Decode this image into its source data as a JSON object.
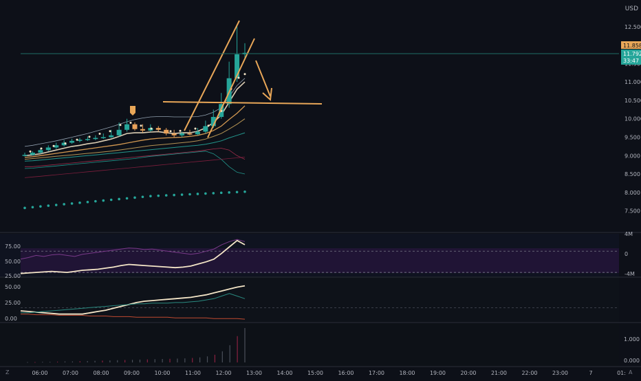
{
  "currency_label": "USD",
  "price_axis": {
    "ticks": [
      "12.500",
      "12.000",
      "11.500",
      "11.000",
      "10.500",
      "10.000",
      "9.500",
      "9.000",
      "8.500",
      "8.000",
      "7.500"
    ],
    "ymin": 7.25,
    "ymax": 13.0,
    "current_price_label": "11.858",
    "last_price_label": "11.792",
    "countdown_label": "33:47",
    "current_price": 11.858,
    "last_price": 11.792
  },
  "osc_axis": {
    "ticks": [
      "75.00",
      "50.00",
      "25.00"
    ],
    "right_ticks": [
      "4M",
      "0",
      "-4M"
    ]
  },
  "adx_axis": {
    "ticks": [
      "50.00",
      "25.00",
      "0.00"
    ]
  },
  "vol_axis": {
    "ticks": [
      "1.000",
      "0.000"
    ]
  },
  "time_axis": {
    "labels": [
      "06:00",
      "07:00",
      "08:00",
      "09:00",
      "10:00",
      "11:00",
      "12:00",
      "13:00",
      "14:00",
      "15:00",
      "16:00",
      "17:00",
      "18:00",
      "19:00",
      "20:00",
      "21:00",
      "22:00",
      "23:00",
      "7",
      "01:"
    ]
  },
  "corner_labels": {
    "left": "Z",
    "right": "A"
  },
  "colors": {
    "background": "#0d1018",
    "bull": "#26a69a",
    "bear": "#e8a15a",
    "annotation": "#e9a758",
    "rsi_band": "#2a1640"
  },
  "chart_data": [
    {
      "type": "candlestick",
      "x": [
        "05:45",
        "06:00",
        "06:15",
        "06:30",
        "06:45",
        "07:00",
        "07:15",
        "07:30",
        "07:45",
        "08:00",
        "08:15",
        "08:30",
        "08:45",
        "09:00",
        "09:15",
        "09:30",
        "09:45",
        "10:00",
        "10:15",
        "10:30",
        "10:45",
        "11:00",
        "11:15",
        "11:30",
        "11:45",
        "12:00",
        "12:15",
        "12:30",
        "12:45"
      ],
      "open": [
        9.0,
        9.02,
        9.08,
        9.15,
        9.22,
        9.28,
        9.35,
        9.4,
        9.43,
        9.45,
        9.48,
        9.5,
        9.55,
        9.7,
        9.85,
        9.72,
        9.68,
        9.75,
        9.7,
        9.6,
        9.55,
        9.6,
        9.58,
        9.65,
        9.8,
        10.05,
        10.4,
        11.1,
        11.75
      ],
      "close": [
        9.02,
        9.08,
        9.15,
        9.22,
        9.28,
        9.35,
        9.4,
        9.43,
        9.45,
        9.48,
        9.5,
        9.55,
        9.7,
        9.85,
        9.72,
        9.68,
        9.75,
        9.7,
        9.6,
        9.55,
        9.6,
        9.58,
        9.65,
        9.8,
        10.05,
        10.4,
        11.1,
        11.75,
        11.79
      ],
      "high": [
        9.08,
        9.12,
        9.2,
        9.28,
        9.35,
        9.42,
        9.46,
        9.48,
        9.52,
        9.55,
        9.6,
        9.7,
        9.9,
        10.0,
        9.9,
        9.85,
        9.85,
        9.8,
        9.75,
        9.7,
        9.65,
        9.7,
        9.75,
        9.95,
        10.25,
        10.7,
        11.55,
        12.55,
        12.05
      ],
      "low": [
        8.98,
        9.0,
        9.05,
        9.12,
        9.18,
        9.25,
        9.32,
        9.36,
        9.4,
        9.42,
        9.45,
        9.48,
        9.52,
        9.65,
        9.68,
        9.62,
        9.65,
        9.65,
        9.55,
        9.5,
        9.5,
        9.55,
        9.55,
        9.6,
        9.75,
        10.0,
        10.3,
        11.0,
        11.6
      ]
    },
    {
      "type": "line",
      "name": "",
      "x_range": [
        "05:45",
        "12:45"
      ],
      "series": [
        {
          "values": [
            9.0,
            9.02,
            9.05,
            9.1,
            9.15,
            9.2,
            9.25,
            9.28,
            9.32,
            9.35,
            9.4,
            9.45,
            9.52,
            9.6,
            9.62,
            9.62,
            9.64,
            9.65,
            9.62,
            9.6,
            9.62,
            9.62,
            9.66,
            9.75,
            9.9,
            10.1,
            10.45,
            10.8,
            11.0
          ]
        },
        {
          "values": [
            8.95,
            8.97,
            9.0,
            9.03,
            9.06,
            9.09,
            9.12,
            9.15,
            9.18,
            9.21,
            9.24,
            9.27,
            9.3,
            9.34,
            9.38,
            9.42,
            9.45,
            9.47,
            9.48,
            9.49,
            9.5,
            9.52,
            9.55,
            9.6,
            9.68,
            9.8,
            9.98,
            10.15,
            10.35
          ]
        },
        {
          "values": [
            8.9,
            8.92,
            8.94,
            8.96,
            8.98,
            9.0,
            9.02,
            9.04,
            9.06,
            9.08,
            9.1,
            9.12,
            9.15,
            9.18,
            9.21,
            9.24,
            9.27,
            9.29,
            9.31,
            9.33,
            9.35,
            9.37,
            9.4,
            9.45,
            9.52,
            9.6,
            9.72,
            9.85,
            10.0
          ]
        },
        {
          "values": [
            8.85,
            8.86,
            8.88,
            8.9,
            8.92,
            8.94,
            8.96,
            8.98,
            9.0,
            9.02,
            9.04,
            9.06,
            9.08,
            9.1,
            9.12,
            9.14,
            9.16,
            9.18,
            9.2,
            9.22,
            9.24,
            9.26,
            9.28,
            9.31,
            9.35,
            9.4,
            9.48,
            9.55,
            9.62
          ]
        },
        {
          "values": [
            9.25,
            9.28,
            9.32,
            9.36,
            9.4,
            9.45,
            9.5,
            9.55,
            9.6,
            9.66,
            9.72,
            9.78,
            9.85,
            9.92,
            9.98,
            10.02,
            10.05,
            10.06,
            10.06,
            10.05,
            10.05,
            10.05,
            10.06,
            10.1,
            10.18,
            10.3,
            10.6,
            10.9,
            11.1
          ]
        },
        {
          "values": [
            8.7,
            8.7,
            8.72,
            8.74,
            8.76,
            8.78,
            8.8,
            8.82,
            8.84,
            8.86,
            8.88,
            8.9,
            8.92,
            8.94,
            8.96,
            8.98,
            9.0,
            9.02,
            9.04,
            9.06,
            9.08,
            9.1,
            9.12,
            9.15,
            9.18,
            9.2,
            9.15,
            9.0,
            8.9
          ]
        },
        {
          "values": [
            8.65,
            8.66,
            8.68,
            8.7,
            8.72,
            8.74,
            8.76,
            8.78,
            8.8,
            8.82,
            8.84,
            8.86,
            8.88,
            8.9,
            8.92,
            8.95,
            8.98,
            9.0,
            9.02,
            9.04,
            9.06,
            9.08,
            9.1,
            9.12,
            9.05,
            8.9,
            8.7,
            8.55,
            8.5
          ]
        },
        {
          "values": [
            8.4,
            8.42,
            8.44,
            8.46,
            8.48,
            8.5,
            8.52,
            8.54,
            8.56,
            8.58,
            8.6,
            8.62,
            8.64,
            8.66,
            8.68,
            8.7,
            8.72,
            8.74,
            8.76,
            8.78,
            8.8,
            8.82,
            8.84,
            8.86,
            8.88,
            8.9,
            8.92,
            8.94,
            8.96
          ]
        }
      ]
    },
    {
      "type": "scatter",
      "name": "",
      "x": [
        "05:45",
        "06:00",
        "06:15",
        "06:30",
        "06:45",
        "07:00",
        "07:15",
        "07:30",
        "07:45",
        "08:00",
        "08:15",
        "08:30",
        "08:45",
        "09:00",
        "09:15",
        "09:30",
        "09:45",
        "10:00",
        "10:15",
        "10:30",
        "10:45",
        "11:00",
        "11:15",
        "11:30",
        "11:45",
        "12:00",
        "12:15",
        "12:30",
        "12:45"
      ],
      "values": [
        7.58,
        7.6,
        7.62,
        7.64,
        7.66,
        7.68,
        7.7,
        7.72,
        7.74,
        7.76,
        7.78,
        7.8,
        7.82,
        7.84,
        7.86,
        7.88,
        7.9,
        7.91,
        7.92,
        7.93,
        7.94,
        7.95,
        7.96,
        7.97,
        7.98,
        7.99,
        8.0,
        8.01,
        8.02
      ]
    },
    {
      "type": "line",
      "name": "",
      "ylim": [
        25,
        100
      ],
      "series": [
        {
          "values": [
            28,
            29,
            30,
            31,
            32,
            31,
            30,
            32,
            34,
            35,
            36,
            38,
            40,
            43,
            45,
            44,
            43,
            42,
            41,
            40,
            39,
            40,
            42,
            46,
            50,
            55,
            66,
            78,
            90,
            82
          ]
        },
        {
          "values": [
            55,
            58,
            62,
            60,
            63,
            64,
            62,
            60,
            64,
            66,
            68,
            70,
            72,
            74,
            76,
            75,
            73,
            74,
            72,
            70,
            68,
            66,
            64,
            66,
            70,
            74,
            82,
            88,
            92,
            88
          ]
        }
      ],
      "levels": [
        70,
        30
      ]
    },
    {
      "type": "line",
      "name": "",
      "ylim": [
        0,
        60
      ],
      "series": [
        {
          "values": [
            15,
            14,
            13,
            12,
            11,
            10,
            10,
            10,
            10,
            12,
            14,
            16,
            19,
            22,
            25,
            28,
            30,
            31,
            32,
            33,
            34,
            35,
            36,
            38,
            40,
            43,
            46,
            49,
            52,
            54
          ]
        },
        {
          "values": [
            12,
            12,
            13,
            14,
            15,
            16,
            17,
            18,
            19,
            20,
            21,
            22,
            23,
            24,
            25,
            26,
            26,
            27,
            27,
            27,
            28,
            28,
            29,
            30,
            32,
            34,
            38,
            42,
            38,
            34
          ]
        },
        {
          "values": [
            10,
            10,
            9,
            9,
            9,
            8,
            8,
            8,
            8,
            7,
            7,
            7,
            6,
            6,
            6,
            5,
            5,
            5,
            5,
            5,
            4,
            4,
            4,
            4,
            4,
            3,
            3,
            3,
            3,
            2
          ]
        }
      ],
      "levels": [
        20
      ]
    },
    {
      "type": "bar",
      "name": "",
      "ylim": [
        0,
        1.8
      ],
      "values": [
        0.02,
        0.02,
        0.03,
        0.03,
        0.04,
        0.05,
        0.05,
        0.06,
        0.07,
        0.08,
        0.09,
        0.1,
        0.11,
        0.12,
        0.13,
        0.14,
        0.15,
        0.16,
        0.17,
        0.18,
        0.19,
        0.2,
        0.22,
        0.25,
        0.3,
        0.38,
        0.55,
        0.85,
        1.3,
        1.7
      ]
    }
  ]
}
